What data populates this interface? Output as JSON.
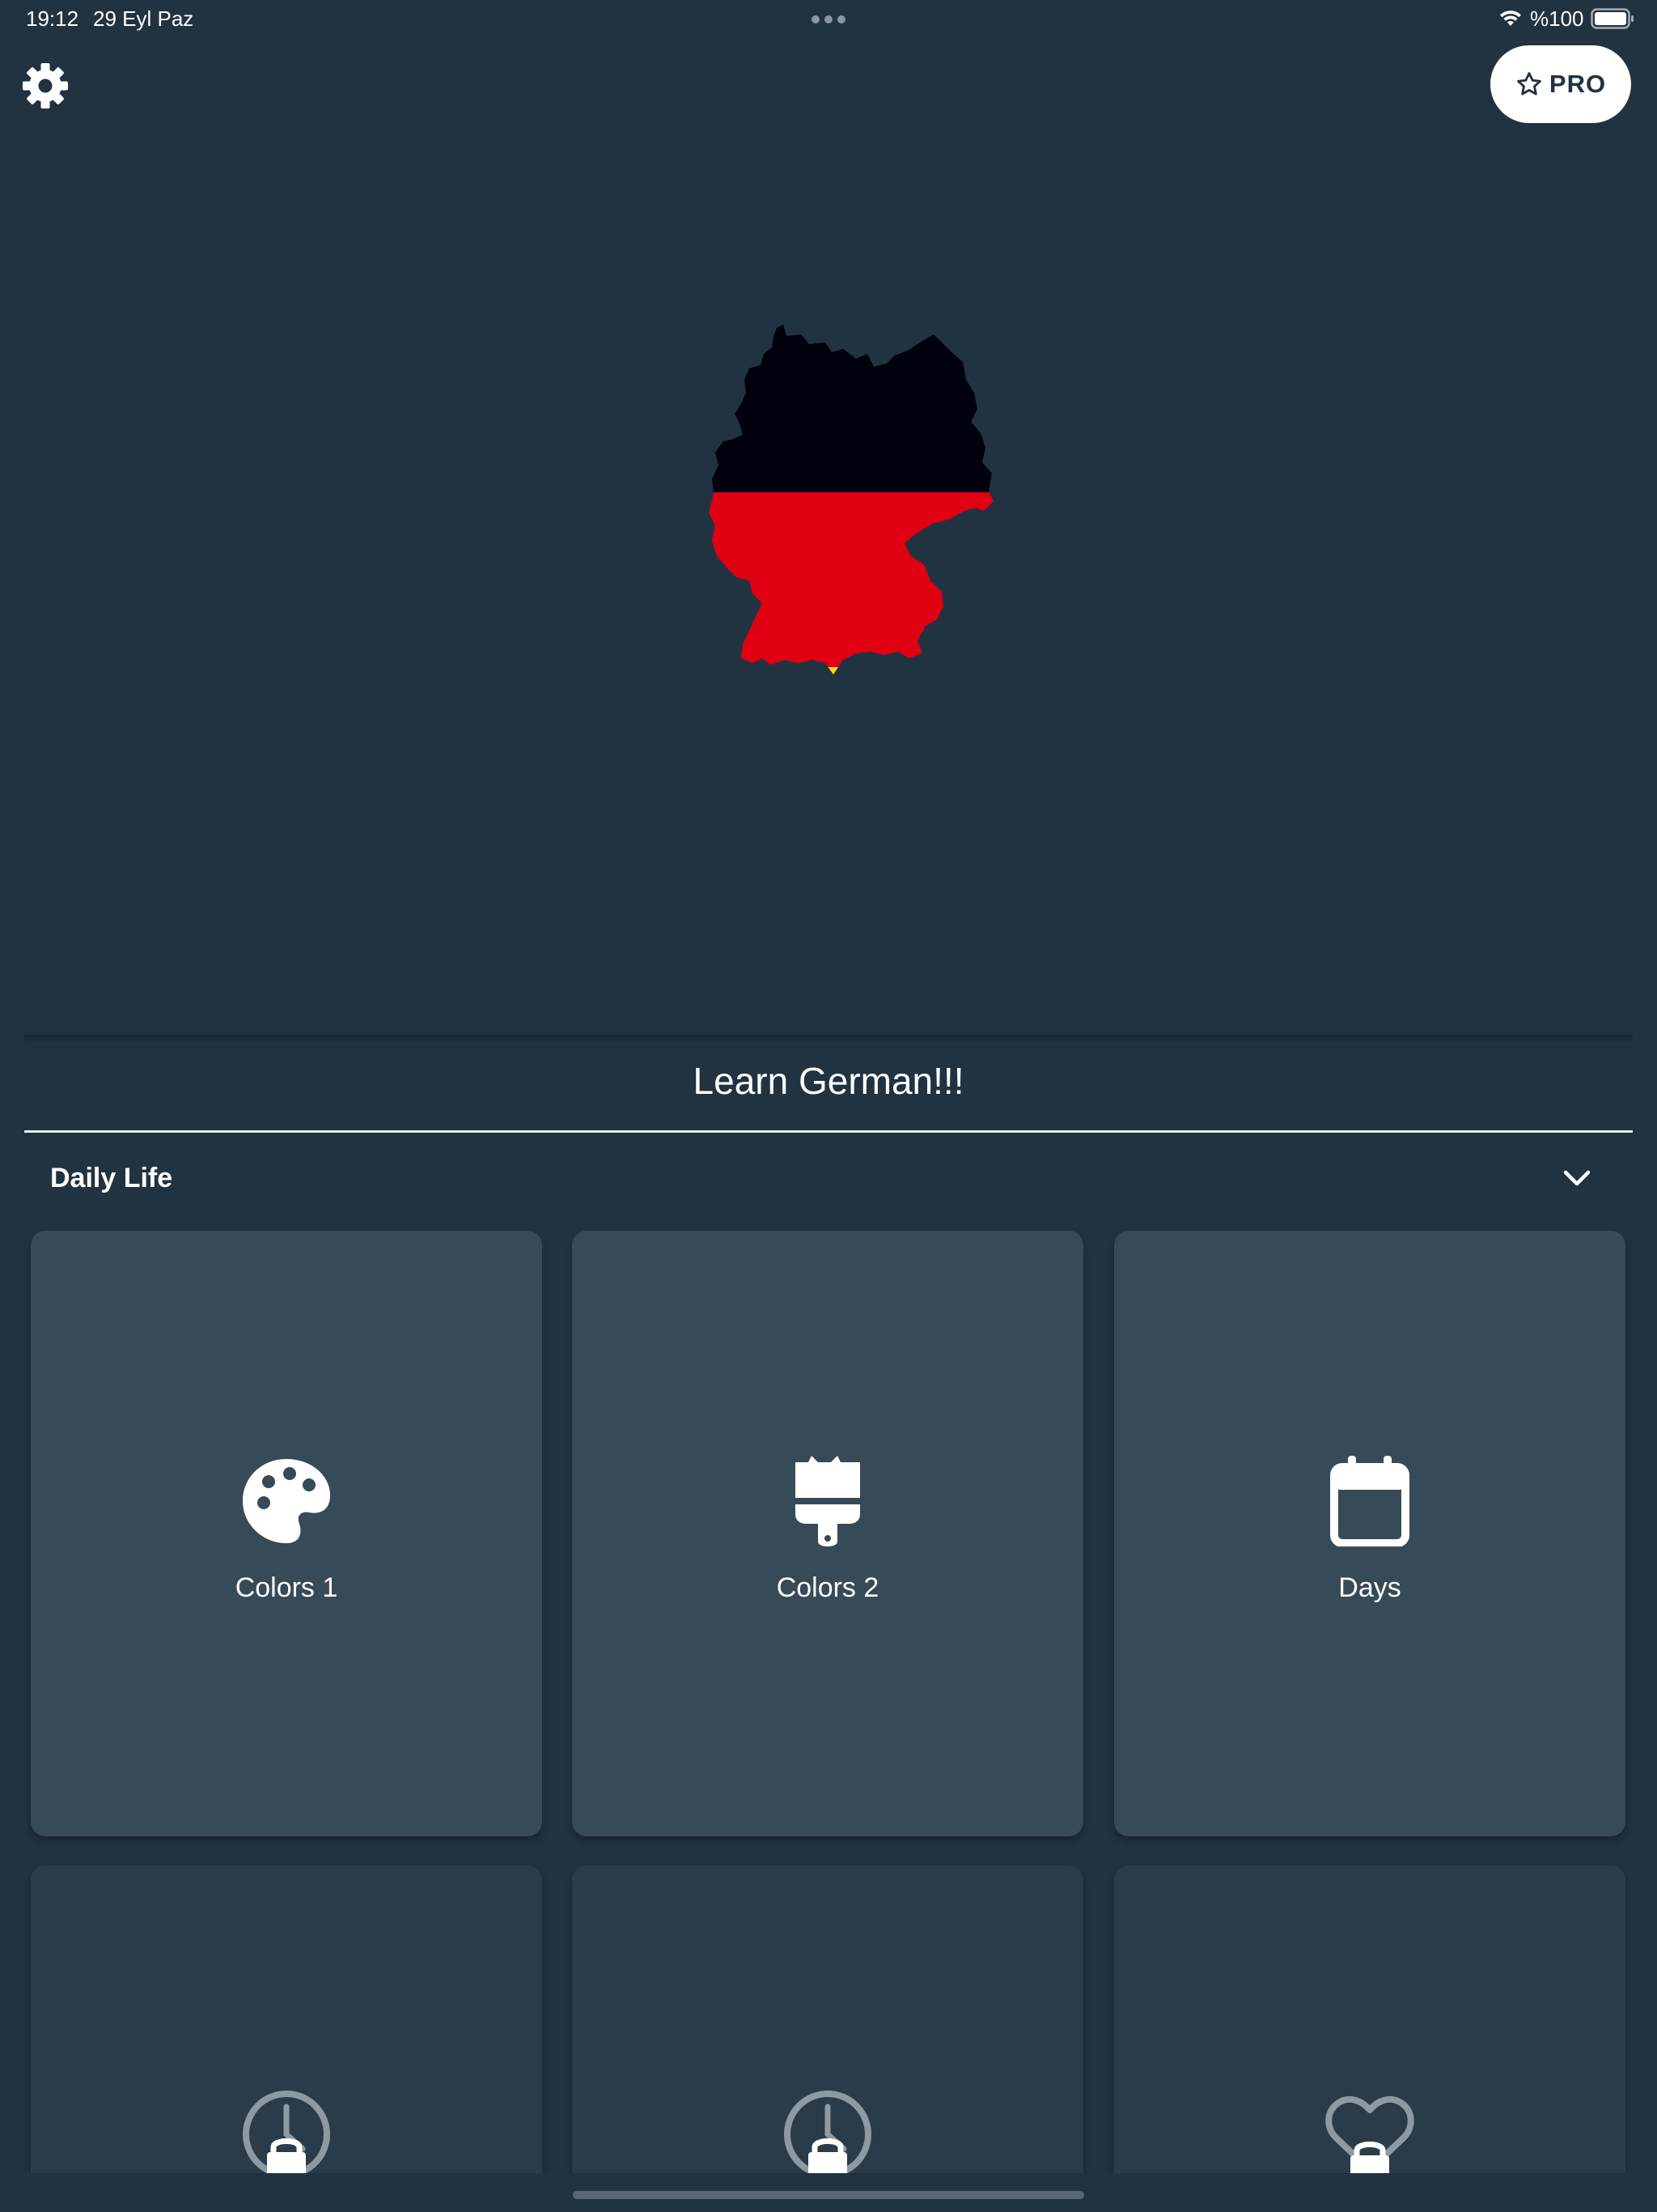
{
  "status_bar": {
    "time": "19:12",
    "date": "29 Eyl Paz",
    "battery": "%100"
  },
  "header": {
    "settings_icon": "gear-icon",
    "pro_label": "PRO",
    "pro_icon": "star-outline-icon"
  },
  "hero": {
    "image": "germany-flag-map",
    "colors": {
      "black": "#00000f",
      "red": "#e10012",
      "gold": "#ffdf13"
    }
  },
  "main": {
    "title": "Learn German!!!",
    "section": {
      "title": "Daily Life",
      "chevron_icon": "chevron-down-icon"
    },
    "cards": [
      {
        "label": "Colors 1",
        "icon": "palette-icon",
        "locked": false
      },
      {
        "label": "Colors 2",
        "icon": "paint-brush-icon",
        "locked": false
      },
      {
        "label": "Days",
        "icon": "calendar-icon",
        "locked": false
      },
      {
        "label": "",
        "icon": "clock-lock-icon",
        "locked": true
      },
      {
        "label": "",
        "icon": "clock-lock-icon",
        "locked": true
      },
      {
        "label": "",
        "icon": "heart-lock-icon",
        "locked": true
      }
    ]
  },
  "colors": {
    "background": "#213341",
    "card": "#374a57",
    "card_locked": "#2a3c49",
    "pro_button": "#ffffff"
  }
}
